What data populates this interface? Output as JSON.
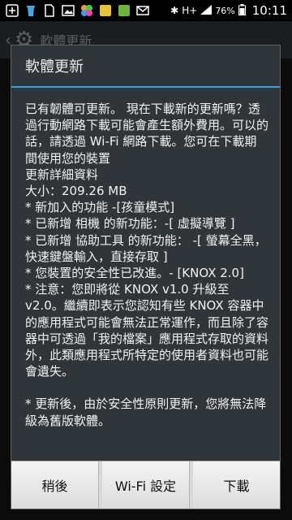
{
  "status_bar": {
    "network": "H+",
    "battery": "76%",
    "time": "10:11"
  },
  "background_app": {
    "title": "軟體更新"
  },
  "dialog": {
    "title": "軟體更新",
    "lines": [
      "已有韌體可更新。 現在下載新的更新嗎？透過行動網路下載可能會產生額外費用。可以的話，請透過 Wi-Fi 網路下載。您可在下載期間使用您的裝置",
      "更新詳細資料",
      "大小：209.26 MB",
      "* 新加入的功能 -[孩童模式]",
      "* 已新增 相機 的新功能：-[ 虛擬導覽 ]",
      "* 已新增 協助工具 的新功能： -[ 螢幕全黑，快速鍵盤輸入，直接存取 ]",
      "* 您裝置的安全性已改進。- [KNOX 2.0]",
      "* 注意：您即將從 KNOX v1.0 升級至 v2.0。繼續即表示您認知有些 KNOX 容器中的應用程式可能會無法正常運作，而且除了容器中可透過「我的檔案」應用程式存取的資料外，此類應用程式所特定的使用者資料也可能會遺失。",
      "* 更新後，由於安全性原則更新，您將無法降級為舊版軟體。"
    ],
    "buttons": {
      "later": "稍後",
      "wifi_settings": "Wi-Fi 設定",
      "download": "下載"
    }
  }
}
